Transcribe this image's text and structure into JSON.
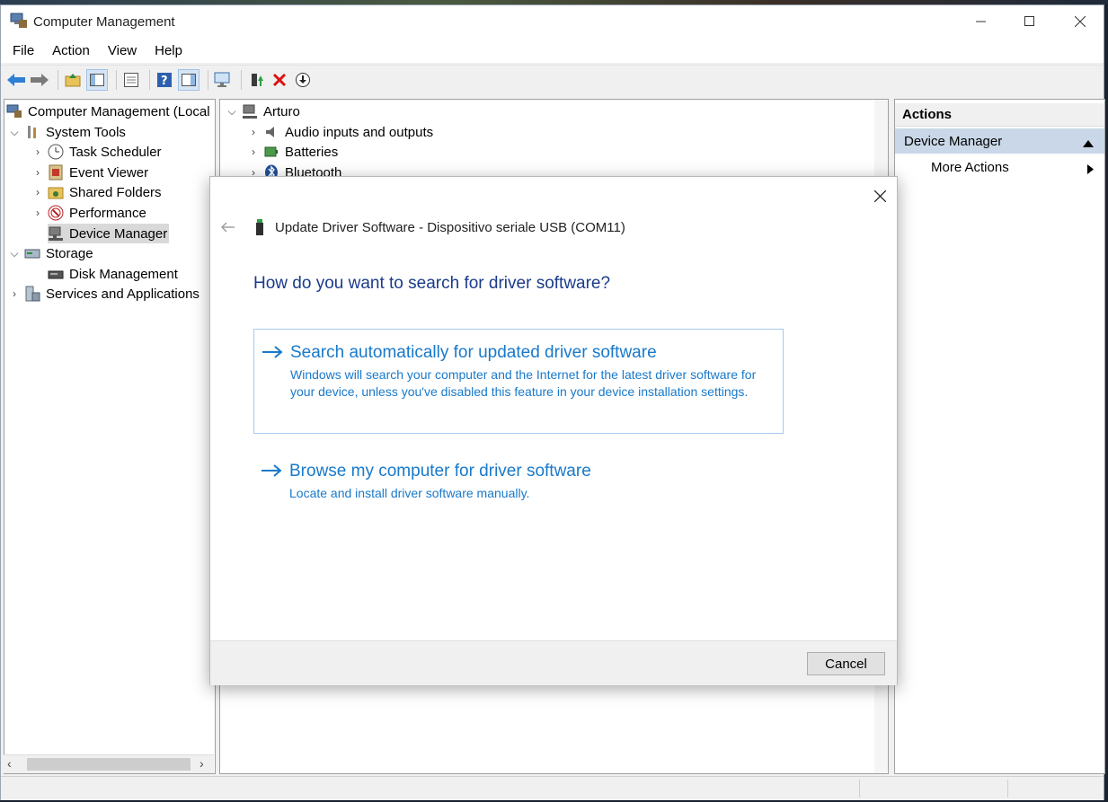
{
  "window": {
    "title": "Computer Management"
  },
  "menubar": [
    "File",
    "Action",
    "View",
    "Help"
  ],
  "tree": {
    "root": "Computer Management (Local",
    "system_tools": "System Tools",
    "task_scheduler": "Task Scheduler",
    "event_viewer": "Event Viewer",
    "shared_folders": "Shared Folders",
    "performance": "Performance",
    "device_manager": "Device Manager",
    "storage": "Storage",
    "disk_management": "Disk Management",
    "services_apps": "Services and Applications"
  },
  "devices": {
    "computer": "Arturo",
    "items": [
      "Audio inputs and outputs",
      "Batteries",
      "Bluetooth"
    ]
  },
  "actions": {
    "header": "Actions",
    "section": "Device Manager",
    "more": "More Actions"
  },
  "dialog": {
    "title": "Update Driver Software - Dispositivo seriale USB (COM11)",
    "question": "How do you want to search for driver software?",
    "option_auto": {
      "title": "Search automatically for updated driver software",
      "desc": "Windows will search your computer and the Internet for the latest driver software for your device, unless you've disabled this feature in your device installation settings."
    },
    "option_browse": {
      "title": "Browse my computer for driver software",
      "desc": "Locate and install driver software manually."
    },
    "cancel": "Cancel"
  },
  "colors": {
    "link_blue": "#1979ca",
    "heading_blue": "#1a3b8a",
    "selection": "#c9d7e8"
  }
}
